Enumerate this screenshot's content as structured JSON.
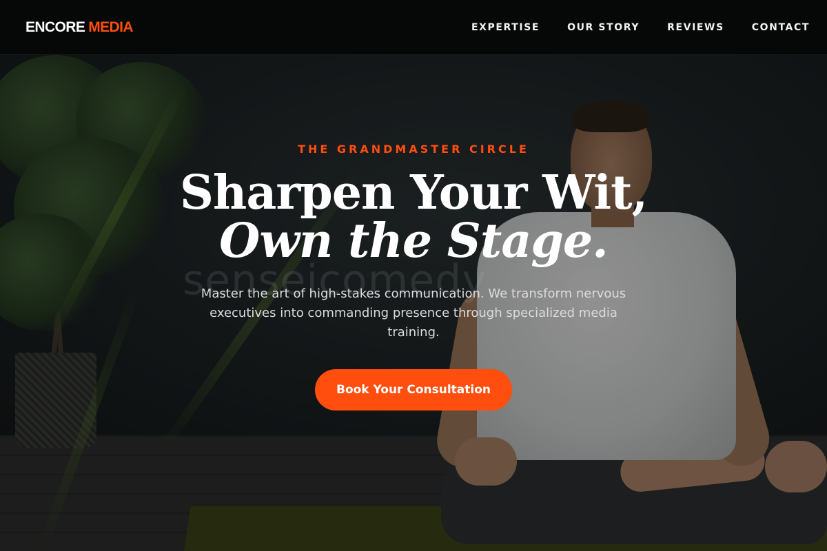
{
  "brand": {
    "name_part1": "ENCORE",
    "name_part2": "MEDIA",
    "accent": "#ff4e0e"
  },
  "nav": {
    "items": [
      {
        "label": "EXPERTISE"
      },
      {
        "label": "OUR STORY"
      },
      {
        "label": "REVIEWS"
      },
      {
        "label": "CONTACT"
      }
    ]
  },
  "hero": {
    "eyebrow": "THE GRANDMASTER CIRCLE",
    "headline_line1": "Sharpen Your Wit,",
    "headline_line2": "Own the Stage.",
    "subtitle": "Master the art of high-stakes communication. We transform nervous executives into commanding presence through specialized media training.",
    "cta_label": "Book Your Consultation",
    "watermark": "senseicomedy"
  },
  "colors": {
    "header_bg": "#060707",
    "accent": "#ff4e0e",
    "text": "#ffffff"
  }
}
